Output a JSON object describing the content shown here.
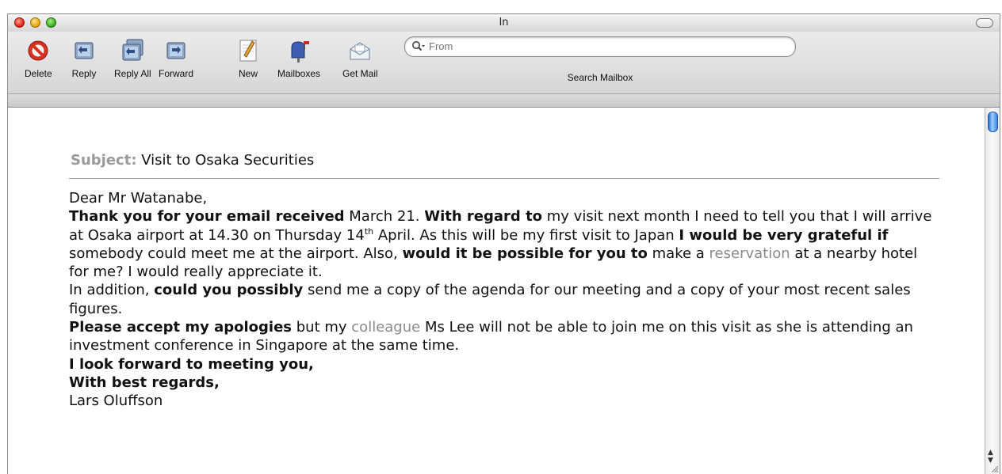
{
  "window": {
    "title": "In"
  },
  "toolbar": {
    "buttons": [
      {
        "label": "Delete",
        "icon": "delete-icon"
      },
      {
        "label": "Reply",
        "icon": "reply-icon"
      },
      {
        "label": "Reply All",
        "icon": "reply-all-icon"
      },
      {
        "label": "Forward",
        "icon": "forward-icon"
      },
      {
        "label": "New",
        "icon": "compose-icon"
      },
      {
        "label": "Mailboxes",
        "icon": "mailboxes-icon"
      },
      {
        "label": "Get Mail",
        "icon": "get-mail-icon"
      }
    ],
    "search": {
      "placeholder": "From",
      "label": "Search Mailbox"
    }
  },
  "email": {
    "subject_label": "Subject:",
    "subject": "Visit to Osaka Securities",
    "greeting": "Dear Mr Watanabe,",
    "p1": {
      "b1": "Thank you for your email received",
      "t1": " March 21. ",
      "b2": "With regard to",
      "t2": " my visit next month I need to tell you that I will arrive at Osaka airport at 14.30 on Thursday 14",
      "sup": "th",
      "t3": " April. As this will be my first visit to Japan ",
      "b3": "I would be very grateful if",
      "t4": " somebody could meet me at the airport. Also, ",
      "b4": "would it be possible for you to",
      "t5": " make a ",
      "g1": "reservation",
      "t6": " at a nearby hotel for me? I would really appreciate it."
    },
    "p2": {
      "t1": "In addition, ",
      "b1": "could you possibly",
      "t2": " send me a copy of the agenda for our meeting and a copy of your most recent sales figures."
    },
    "p3": {
      "b1": "Please accept my apologies",
      "t1": " but my ",
      "g1": "colleague",
      "t2": " Ms Lee will not be able to join me on this visit as she is attending an investment conference in Singapore at the same time."
    },
    "closing1": "I look forward to meeting you,",
    "closing2": "With best regards,",
    "signature": "Lars Oluffson"
  },
  "colors": {
    "label_gray": "#9a9a9a",
    "highlight_gray": "#8a8a8a",
    "thumb_blue": "#2d6fd0"
  }
}
